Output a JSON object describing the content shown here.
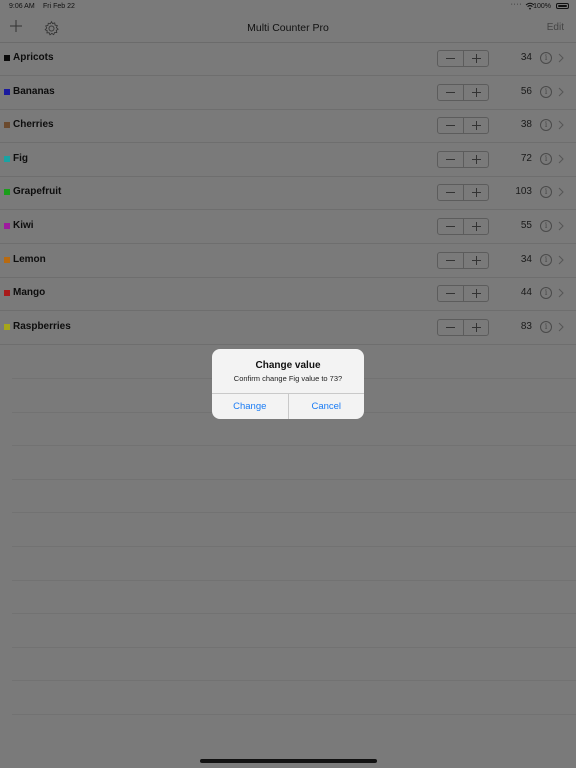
{
  "status_bar": {
    "time": "9:06 AM",
    "date": "Fri Feb 22",
    "battery": "100%"
  },
  "nav": {
    "title": "Multi Counter Pro",
    "edit_label": "Edit",
    "add_icon": "plus-icon",
    "settings_icon": "gear-icon"
  },
  "counters": [
    {
      "name": "Apricots",
      "value": "34",
      "color": "#0a0a0a"
    },
    {
      "name": "Bananas",
      "value": "56",
      "color": "#1a1a9e"
    },
    {
      "name": "Cherries",
      "value": "38",
      "color": "#6b4a2e"
    },
    {
      "name": "Fig",
      "value": "72",
      "color": "#1aa3a3"
    },
    {
      "name": "Grapefruit",
      "value": "103",
      "color": "#1a9e1a"
    },
    {
      "name": "Kiwi",
      "value": "55",
      "color": "#9e1a9e"
    },
    {
      "name": "Lemon",
      "value": "34",
      "color": "#b86a10"
    },
    {
      "name": "Mango",
      "value": "44",
      "color": "#a81a1a"
    },
    {
      "name": "Raspberries",
      "value": "83",
      "color": "#a6a61a"
    }
  ],
  "alert": {
    "title": "Change value",
    "message": "Confirm change Fig value to 73?",
    "confirm_label": "Change",
    "cancel_label": "Cancel"
  }
}
